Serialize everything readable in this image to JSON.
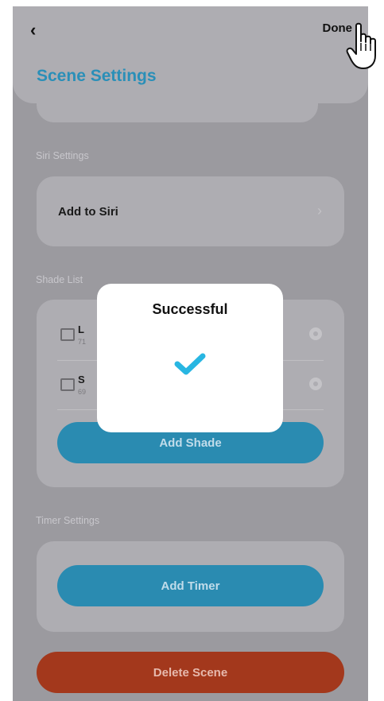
{
  "nav": {
    "back_icon": "chevron-left-icon",
    "back_glyph": "‹",
    "done_label": "Done"
  },
  "page": {
    "title": "Scene Settings"
  },
  "siri": {
    "section_label": "Siri Settings",
    "add_label": "Add to Siri",
    "chevron_glyph": "›"
  },
  "shades": {
    "section_label": "Shade List",
    "items": [
      {
        "name": "L",
        "sub": "71"
      },
      {
        "name": "S",
        "sub": "69"
      }
    ],
    "add_label": "Add Shade"
  },
  "timer": {
    "section_label": "Timer Settings",
    "add_label": "Add Timer"
  },
  "delete_label": "Delete Scene",
  "modal": {
    "title": "Successful",
    "icon": "checkmark-icon"
  },
  "colors": {
    "accent": "#2a8fb8",
    "button": "#2a8bb1",
    "danger": "#a3381c",
    "check": "#28b6e2"
  }
}
